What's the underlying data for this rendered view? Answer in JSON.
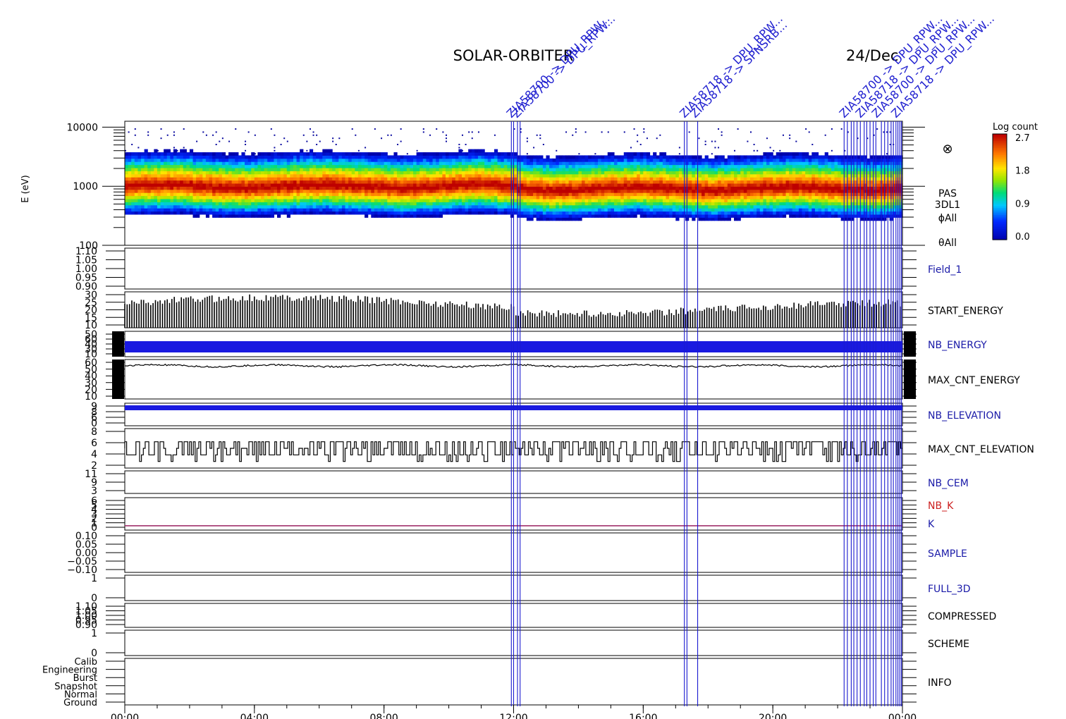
{
  "title": {
    "mission": "SOLAR-ORBITER",
    "date": "24/Dec"
  },
  "chart_data": {
    "type": "spectrogram-stack",
    "x_ticks": [
      "00:00",
      "04:00",
      "08:00",
      "12:00",
      "16:00",
      "20:00",
      "00:00"
    ],
    "x_range_hours": [
      0,
      24
    ],
    "event_lines_hours": [
      11.93,
      12.0,
      12.12,
      12.2,
      17.27,
      17.35,
      17.68,
      22.2,
      22.3,
      22.42,
      22.5,
      22.6,
      22.7,
      22.82,
      22.9,
      23.0,
      23.1,
      23.18,
      23.35,
      23.45,
      23.55,
      23.65,
      23.72,
      23.8,
      23.86,
      23.92,
      23.97
    ],
    "event_labels": [
      {
        "text": "ZIA58700 -> DPU_RPW...",
        "x": 11.93
      },
      {
        "text": "ZIA58700 -> DPU_RPW...",
        "x": 12.1
      },
      {
        "text": "ZIA58718 -> DPU_RPW...",
        "x": 17.27
      },
      {
        "text": "ZIA58718 -> SPNSRB...",
        "x": 17.6
      },
      {
        "text": "ZIA58700 -> DPU_RPW...",
        "x": 22.2
      },
      {
        "text": "ZIA58718 -> DPU_RPW...",
        "x": 22.7
      },
      {
        "text": "ZIA58700 -> DPU_RPW...",
        "x": 23.2
      },
      {
        "text": "ZIA58718 -> DPU_RPW...",
        "x": 23.8
      }
    ],
    "colorbar": {
      "label": "Log count",
      "ticks": [
        "2.7",
        "1.8",
        "0.9",
        "0.0"
      ],
      "range": [
        0,
        2.7
      ]
    },
    "panels": [
      {
        "id": "spectrogram",
        "label_lines": [
          "PAS",
          "3DL1",
          "ϕAll",
          "θAll"
        ],
        "ylabel": "E (eV)",
        "ticks": [
          {
            "v": 4,
            "t": "10000"
          },
          {
            "v": 3,
            "t": "1000"
          },
          {
            "v": 2,
            "t": "100"
          }
        ],
        "y_log_range": [
          2,
          4.1
        ],
        "band_center_log": 3.0,
        "band_halfwidth_log": 0.5
      },
      {
        "id": "field1",
        "label": "Field_1",
        "label_color": "#1a1aa8",
        "ticks": [
          "1.10",
          "1.05",
          "1.00",
          "0.95",
          "0.90"
        ],
        "range": [
          0.9,
          1.1
        ]
      },
      {
        "id": "start_energy",
        "label": "START_ENERGY",
        "label_color": "#000000",
        "ticks": [
          "30",
          "25",
          "20",
          "15",
          "10"
        ],
        "range": [
          10,
          30
        ],
        "typical_value": 23
      },
      {
        "id": "nb_energy",
        "label": "NB_ENERGY",
        "label_color": "#1a1aa8",
        "ticks": [
          "50",
          "60",
          "40",
          "30",
          "10"
        ],
        "range": [
          0,
          60
        ],
        "typical_value": 48
      },
      {
        "id": "max_cnt_energy",
        "label": "MAX_CNT_ENERGY",
        "label_color": "#000000",
        "ticks": [
          "60",
          "50",
          "40",
          "30",
          "20",
          "10"
        ],
        "range": [
          10,
          60
        ],
        "typical_value": 52
      },
      {
        "id": "nb_elevation",
        "label": "NB_ELEVATION",
        "label_color": "#1a1aa8",
        "ticks": [
          "9",
          "8",
          "6",
          "0"
        ],
        "range": [
          0,
          9
        ],
        "typical_value": 9
      },
      {
        "id": "max_cnt_elevation",
        "label": "MAX_CNT_ELEVATION",
        "label_color": "#000000",
        "ticks": [
          "8",
          "6",
          "4",
          "2"
        ],
        "range": [
          2,
          8
        ],
        "typical_value": 5
      },
      {
        "id": "nb_cem",
        "label": "NB_CEM",
        "label_color": "#1a1aa8",
        "ticks": [
          "11",
          "9",
          "3"
        ],
        "range": [
          0,
          11
        ]
      },
      {
        "id": "nb_k",
        "label": "NB_K",
        "label2": "K",
        "label_color": "#cc2020",
        "label2_color": "#1a1aa8",
        "ticks": [
          "6",
          "5",
          "4",
          "3",
          "2",
          "1",
          "0"
        ],
        "range": [
          0,
          6
        ],
        "typical_value": 0.8
      },
      {
        "id": "sample",
        "label": "SAMPLE",
        "label_color": "#1a1aa8",
        "ticks": [
          "0.10",
          "0.05",
          "0.00",
          "−0.05",
          "−0.10"
        ],
        "range": [
          -0.1,
          0.1
        ]
      },
      {
        "id": "full_3d",
        "label": "FULL_3D",
        "label_color": "#1a1aa8",
        "ticks": [
          "1",
          "0"
        ],
        "range": [
          0,
          1
        ]
      },
      {
        "id": "compressed",
        "label": "COMPRESSED",
        "label_color": "#000000",
        "ticks": [
          "1.10",
          "1.05",
          "1.00",
          "0.95",
          "0.90"
        ],
        "range": [
          0.9,
          1.1
        ]
      },
      {
        "id": "scheme",
        "label": "SCHEME",
        "label_color": "#000000",
        "ticks": [
          "1",
          "0"
        ],
        "range": [
          0,
          1
        ]
      },
      {
        "id": "info",
        "label": "INFO",
        "label_color": "#000000",
        "ticks": [
          "Calib",
          "Engineering",
          "Burst",
          "Snapshot",
          "Normal",
          "Ground"
        ]
      }
    ]
  }
}
